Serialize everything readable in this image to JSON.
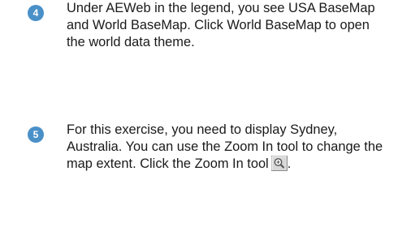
{
  "steps": [
    {
      "number": "4",
      "text": "Under AEWeb in the legend, you see USA BaseMap and World BaseMap. Click World BaseMap to open the world data theme."
    },
    {
      "number": "5",
      "text_before_icon": "For this exercise, you need to display Sydney, Australia. You can use the Zoom In tool to change the map extent. Click the Zoom In tool",
      "text_after_icon": ".",
      "icon": "zoom-in-tool-icon"
    }
  ],
  "colors": {
    "badge": "#4a90c8",
    "text": "#1a1a1a"
  }
}
